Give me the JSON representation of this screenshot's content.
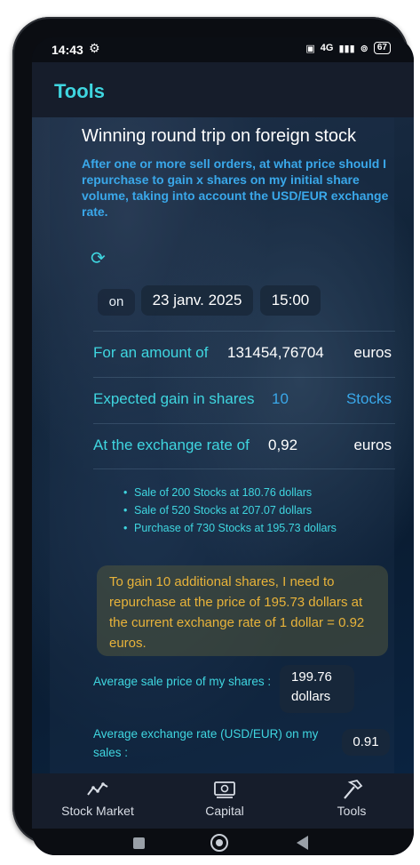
{
  "status": {
    "time": "14:43",
    "network": "4G",
    "battery": "67"
  },
  "header": {
    "title": "Tools"
  },
  "section": {
    "title": "Winning round trip on foreign stock",
    "subtitle": "After one or more sell orders, at what price should I repurchase to gain x shares on my initial share volume, taking into account the USD/EUR exchange rate."
  },
  "datetime": {
    "on_label": "on",
    "date": "23 janv. 2025",
    "time": "15:00"
  },
  "form": {
    "amount_label": "For an amount of",
    "amount_value": "131454,76704",
    "amount_unit": "euros",
    "gain_label": "Expected gain in shares",
    "gain_value": "10",
    "gain_unit": "Stocks",
    "rate_label": "At the exchange rate of",
    "rate_value": "0,92",
    "rate_unit": "euros"
  },
  "orders": [
    "Sale of 200 Stocks at 180.76 dollars",
    "Sale of 520 Stocks at 207.07 dollars",
    "Purchase of 730 Stocks at 195.73 dollars"
  ],
  "result": "To gain 10 additional shares, I need to repurchase at the price of 195.73 dollars at the current exchange rate of 1 dollar = 0.92 euros.",
  "stats": {
    "avg_price_label": "Average sale price of my shares :",
    "avg_price_value": "199.76 dollars",
    "avg_rate_label": "Average exchange rate (USD/EUR) on my sales :",
    "avg_rate_value": "0.91"
  },
  "nav": {
    "stock_market": "Stock Market",
    "capital": "Capital",
    "tools": "Tools"
  },
  "colors": {
    "accent": "#3fd6e0",
    "link": "#3aa8ea",
    "result_text": "#e8b33a"
  }
}
